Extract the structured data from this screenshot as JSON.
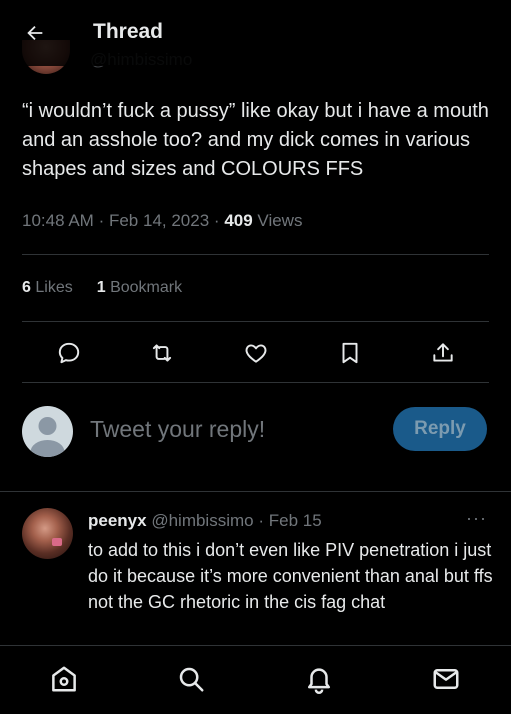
{
  "header": {
    "title": "Thread",
    "behind_handle": "@himbissimo"
  },
  "tweet": {
    "text": "“i wouldn’t fuck a pussy” like okay but i have a mouth and an asshole too? and my dick comes in various shapes and sizes and COLOURS FFS",
    "time": "10:48 AM",
    "date": "Feb 14, 2023",
    "views_count": "409",
    "views_label": "Views",
    "likes_count": "6",
    "likes_label": "Likes",
    "bookmarks_count": "1",
    "bookmarks_label": "Bookmark",
    "separator": "·"
  },
  "actions": [
    {
      "icon": "reply-icon"
    },
    {
      "icon": "retweet-icon"
    },
    {
      "icon": "like-icon"
    },
    {
      "icon": "bookmark-icon"
    },
    {
      "icon": "share-icon"
    }
  ],
  "compose": {
    "placeholder": "Tweet your reply!",
    "button_label": "Reply"
  },
  "reply": {
    "name": "peenyx",
    "handle": "@himbissimo",
    "date": "Feb 15",
    "more": "···",
    "text": "to add to this i don’t even like PIV penetration i just do it because it’s more convenient than anal but ffs not the GC rhetoric in the cis fag chat"
  },
  "bottom_nav": [
    {
      "icon": "home-icon"
    },
    {
      "icon": "search-icon"
    },
    {
      "icon": "notifications-icon"
    },
    {
      "icon": "messages-icon"
    }
  ],
  "colors": {
    "background": "#000000",
    "text": "#e7e9ea",
    "muted": "#71767b",
    "divider": "#2f3336",
    "reply_button": "#1a5a8a"
  }
}
